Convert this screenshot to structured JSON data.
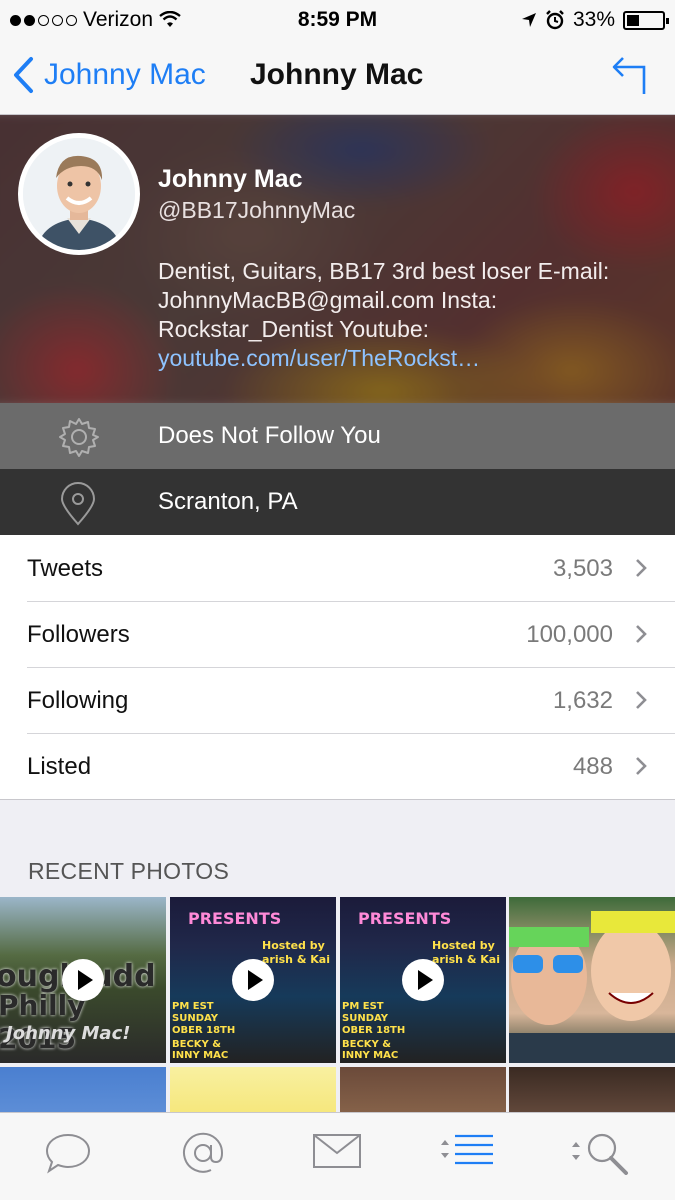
{
  "status_bar": {
    "carrier": "Verizon",
    "time": "8:59 PM",
    "battery": "33%",
    "battery_level": 0.33,
    "signal_bars": 2
  },
  "nav": {
    "back_label": "Johnny Mac",
    "title": "Johnny Mac",
    "accent_color": "#1e7ef5"
  },
  "profile": {
    "name": "Johnny Mac",
    "handle": "@BB17JohnnyMac",
    "bio_text": "Dentist, Guitars, BB17 3rd best loser E-mail: JohnnyMacBB@gmail.com  Insta: Rockstar_Dentist Youtube: ",
    "bio_link": "youtube.com/user/TheRockst…"
  },
  "info": {
    "follow_status": "Does Not Follow You",
    "location": "Scranton, PA"
  },
  "stats": [
    {
      "label": "Tweets",
      "value": "3,503"
    },
    {
      "label": "Followers",
      "value": "100,000"
    },
    {
      "label": "Following",
      "value": "1,632"
    },
    {
      "label": "Listed",
      "value": "488"
    }
  ],
  "recent_photos": {
    "title": "RECENT PHOTOS",
    "thumb_text": {
      "p1_line1": "ough udd",
      "p1_line2": "Philly 2015",
      "p1_line3": "Johnny Mac!",
      "p2_header": "PRESENTS",
      "p2_hosted": "Hosted by",
      "p2_hosts": "arish & Kai",
      "p2_details": "PM EST SUNDAY OBER 18TH",
      "p2_names": "BECKY & INNY MAC",
      "p3_header": "PRESENTS",
      "p3_hosted": "Hosted by",
      "p3_hosts": "arish & Kai",
      "p3_details": "PM EST SUNDAY OBER 18TH",
      "p3_names": "BECKY & INNY MAC"
    }
  },
  "tab_bar": {
    "tabs": [
      "chat-bubble-icon",
      "mention-icon",
      "envelope-icon",
      "timeline-list-icon",
      "search-icon"
    ],
    "active_tab": "timeline-list-icon"
  }
}
